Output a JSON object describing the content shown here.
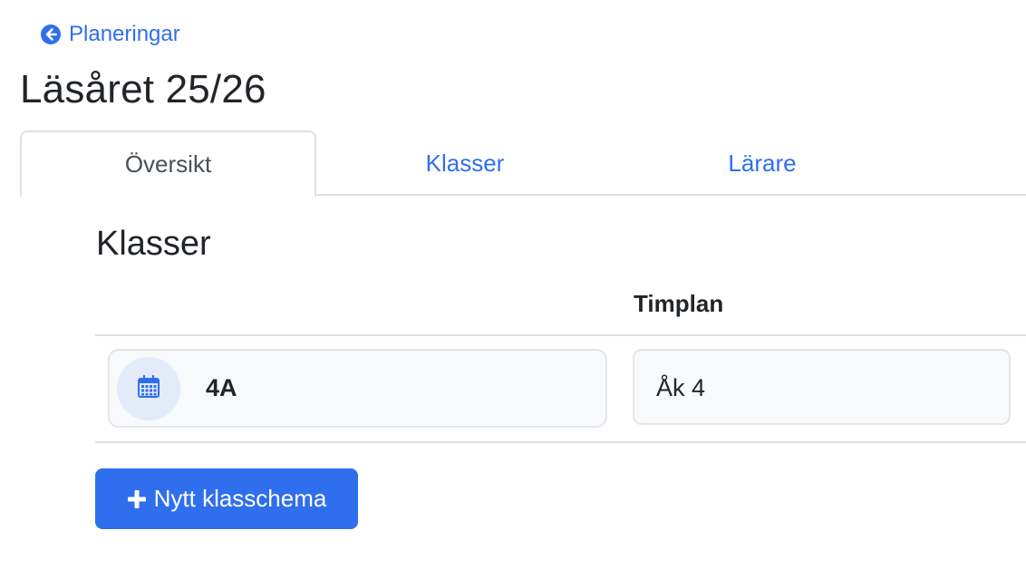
{
  "back_link": {
    "label": "Planeringar",
    "icon": "arrow-left-circle-icon"
  },
  "page_title": "Läsåret 25/26",
  "tabs": [
    {
      "label": "Översikt",
      "active": true
    },
    {
      "label": "Klasser",
      "active": false
    },
    {
      "label": "Lärare",
      "active": false
    }
  ],
  "section": {
    "title": "Klasser",
    "columns": [
      "",
      "Timplan"
    ],
    "rows": [
      {
        "class_name": "4A",
        "icon": "calendar-icon",
        "timplan": "Åk 4"
      }
    ]
  },
  "actions": {
    "new_schedule_label": "Nytt klasschema",
    "icon": "plus-icon"
  },
  "colors": {
    "accent": "#2f6fed",
    "border": "#dee2e6",
    "card_bg": "#f8f9fa",
    "icon_bg": "#e3ebf8"
  }
}
